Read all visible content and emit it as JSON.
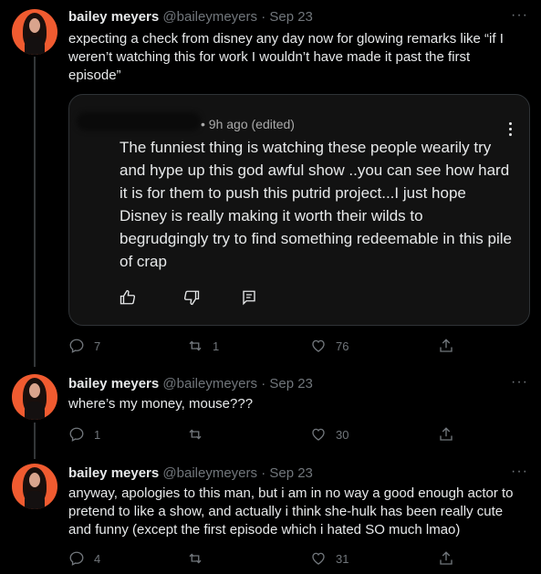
{
  "tweets": [
    {
      "name": "bailey meyers",
      "handle": "@baileymeyers",
      "date": "Sep 23",
      "text": "expecting a check from disney any day now for glowing remarks like “if I weren’t watching this for work I wouldn’t have made it past the first episode”",
      "more": "···",
      "replies": "7",
      "retweets": "1",
      "likes": "76",
      "quote": {
        "meta": "• 9h ago (edited)",
        "text": "The funniest thing is watching these people wearily try and hype up this god awful show ..you can see how hard it is for them to push this putrid project...I just hope Disney is really making it worth their wilds to begrudgingly try to find something redeemable in this pile of crap"
      }
    },
    {
      "name": "bailey meyers",
      "handle": "@baileymeyers",
      "date": "Sep 23",
      "text": "where’s my money, mouse???",
      "more": "···",
      "replies": "1",
      "retweets": "",
      "likes": "30"
    },
    {
      "name": "bailey meyers",
      "handle": "@baileymeyers",
      "date": "Sep 23",
      "text": "anyway, apologies to this man, but i am in no way a good enough actor to pretend to like a show, and actually i think she-hulk has been really cute and funny (except the first episode which i hated SO much lmao)",
      "more": "···",
      "replies": "4",
      "retweets": "",
      "likes": "31"
    }
  ]
}
